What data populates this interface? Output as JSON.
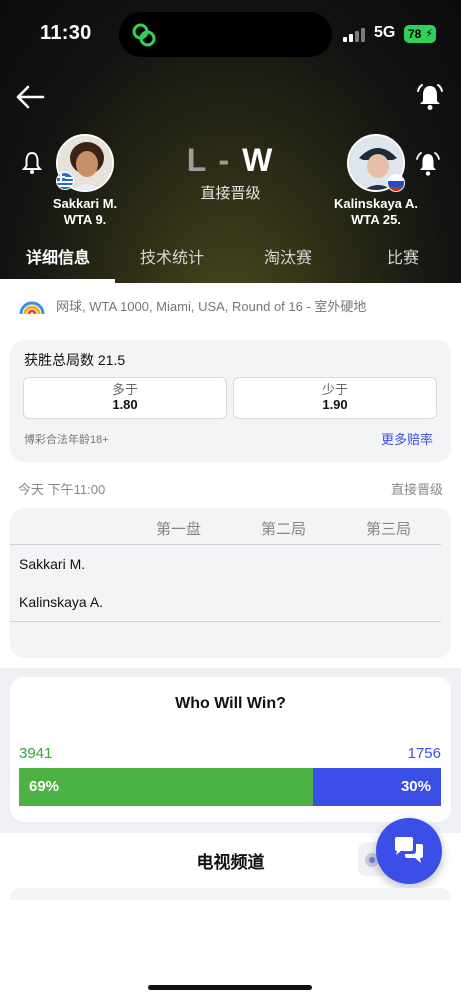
{
  "status_bar": {
    "time": "11:30",
    "network": "5G",
    "battery": "78"
  },
  "match": {
    "score_left": "L",
    "score_sep": "-",
    "score_right": "W",
    "status": "直接晋级",
    "player_left": {
      "name": "Sakkari M.",
      "rank": "WTA 9."
    },
    "player_right": {
      "name": "Kalinskaya A.",
      "rank": "WTA 25."
    }
  },
  "tabs": [
    {
      "label": "详细信息",
      "active": true
    },
    {
      "label": "技术统计",
      "active": false
    },
    {
      "label": "淘汰赛",
      "active": false
    },
    {
      "label": "比赛",
      "active": false
    }
  ],
  "tournament_info": "网球, WTA 1000, Miami, USA, Round of 16 - 室外硬地",
  "odds": {
    "title": "获胜总局数 21.5",
    "over_label": "多于",
    "over_value": "1.80",
    "under_label": "少于",
    "under_value": "1.90",
    "legal": "博彩合法年龄18+",
    "more_link": "更多赔率"
  },
  "schedule": {
    "time": "今天 下午11:00",
    "state": "直接晋级"
  },
  "sets": {
    "headers": [
      "第一盘",
      "第二局",
      "第三局"
    ],
    "rows": [
      "Sakkari M.",
      "Kalinskaya A."
    ]
  },
  "poll": {
    "title": "Who Will Win?",
    "votes_left": "3941",
    "votes_right": "1756",
    "pct_left": "69%",
    "pct_right": "30%",
    "fraction_left": 0.69,
    "fraction_right": 0.3
  },
  "tv": {
    "title": "电视频道"
  },
  "colors": {
    "accent_blue": "#3b4ee8",
    "accent_green": "#4cb244"
  }
}
